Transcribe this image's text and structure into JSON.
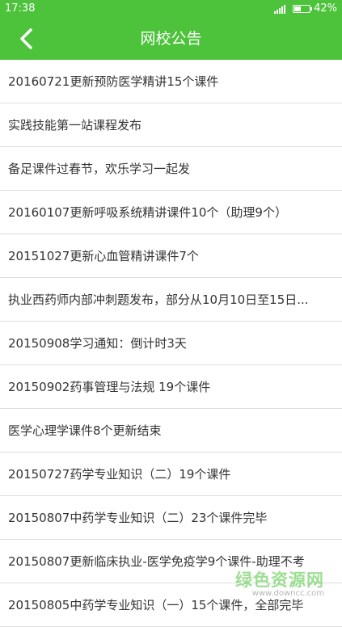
{
  "status_bar": {
    "time": "17:38",
    "battery_text": "42%",
    "battery_level": 0.42
  },
  "header": {
    "title": "网校公告"
  },
  "announcements": [
    "20160721更新预防医学精讲15个课件",
    "实践技能第一站课程发布",
    "备足课件过春节，欢乐学习一起发",
    "20160107更新呼吸系统精讲课件10个（助理9个）",
    "20151027更新心血管精讲课件7个",
    "执业西药师内部冲刺题发布，部分从10月10日至15日...",
    "20150908学习通知：倒计时3天",
    "20150902药事管理与法规 19个课件",
    "医学心理学课件8个更新结束",
    "20150727药学专业知识（二）19个课件",
    "20150807中药学专业知识（二）23个课件完毕",
    "20150807更新临床执业-医学免疫学9个课件-助理不考",
    "20150805中药学专业知识（一）15个课件，全部完毕"
  ],
  "watermark": {
    "text": "绿色资源网",
    "sub": "www.downcc.com"
  },
  "colors": {
    "brand": "#4cc33b",
    "divider": "#dddddd",
    "text": "#333333"
  }
}
